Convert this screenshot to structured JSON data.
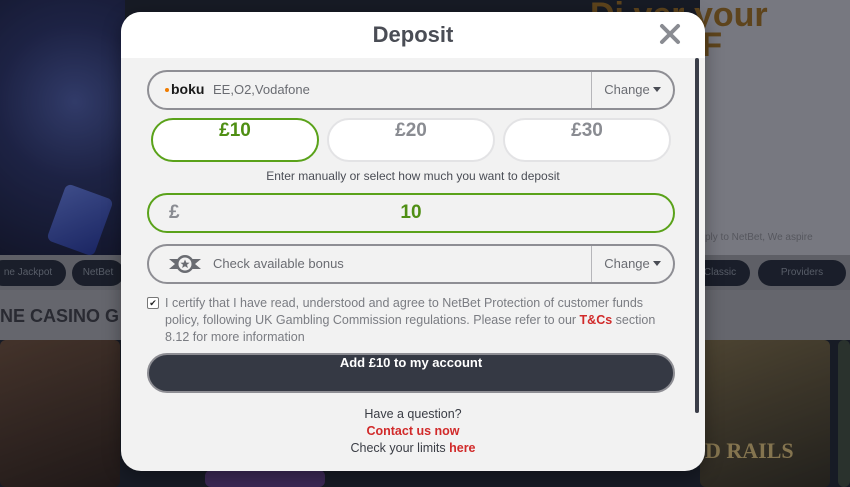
{
  "background": {
    "hero_title_line1": "Di  ver your",
    "hero_title_line2": "on the F",
    "hero_small_text": "ply to NetBet, We aspire",
    "pills": [
      "ne Jackpot",
      "NetBet",
      "Classic",
      "Providers"
    ],
    "section_title": "NE CASINO G",
    "game_label": "D RAILS"
  },
  "modal": {
    "title": "Deposit",
    "payment": {
      "provider_logo": "boku",
      "carriers": "EE,O2,Vodafone",
      "change_label": "Change"
    },
    "amount_options": [
      "£10",
      "£20",
      "£30"
    ],
    "selected_amount_index": 0,
    "hint": "Enter manually or select how much you want to deposit",
    "amount_input": {
      "currency": "£",
      "value": "10"
    },
    "bonus": {
      "label": "Check available bonus",
      "change_label": "Change"
    },
    "certify": {
      "checked": true,
      "text_before": "I certify that I have read, understood and agree to NetBet Protection of customer funds policy, following UK Gambling Commission regulations. Please refer to our ",
      "link": "T&Cs",
      "text_after": " section 8.12 for more information"
    },
    "cta_label": "Add £10 to my account",
    "footer": {
      "question": "Have a question?",
      "contact_link": "Contact us now",
      "limits_text": "Check your limits ",
      "limits_link": "here"
    }
  },
  "colors": {
    "accent_green": "#5aa21a",
    "link_red": "#d12a2a",
    "cta_bg": "#353944"
  }
}
